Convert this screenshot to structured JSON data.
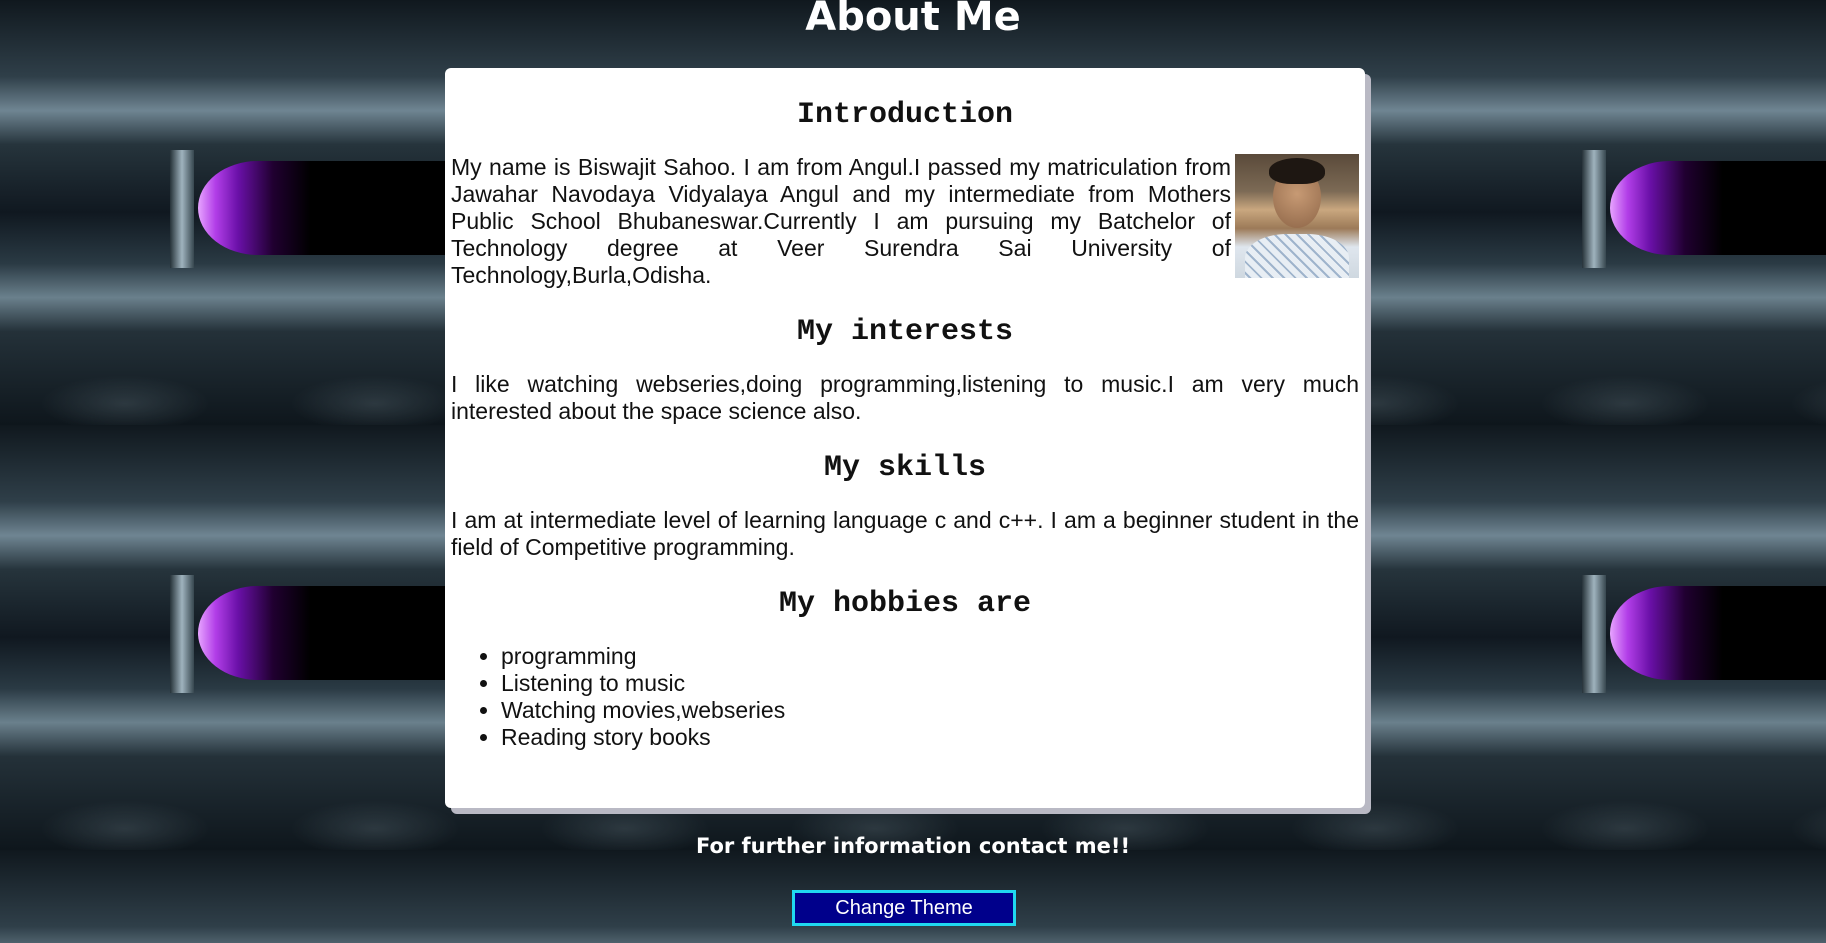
{
  "page": {
    "title": "About Me"
  },
  "card": {
    "introduction": {
      "heading": "Introduction",
      "text": "My name is Biswajit Sahoo. I am from Angul.I passed my matriculation from Jawahar Navodaya Vidyalaya Angul and my intermediate from Mothers Public School Bhubaneswar.Currently I am pursuing my Batchelor of Technology degree at Veer Surendra Sai University of Technology,Burla,Odisha."
    },
    "interests": {
      "heading": "My interests",
      "text": "I like watching webseries,doing programming,listening to music.I am very much interested about the space science also."
    },
    "skills": {
      "heading": "My skills",
      "text": "I am at intermediate level of learning language c and c++. I am a beginner student in the field of Competitive programming."
    },
    "hobbies": {
      "heading": "My hobbies are",
      "items": [
        "programming",
        "Listening to music",
        "Watching movies,webseries",
        "Reading story books"
      ]
    }
  },
  "footer": {
    "text": "For further information contact me!!"
  },
  "theme_button": {
    "label": "Change Theme"
  },
  "colors": {
    "button_bg": "#00008b",
    "button_border": "#20d8f0",
    "card_bg": "#ffffff"
  }
}
